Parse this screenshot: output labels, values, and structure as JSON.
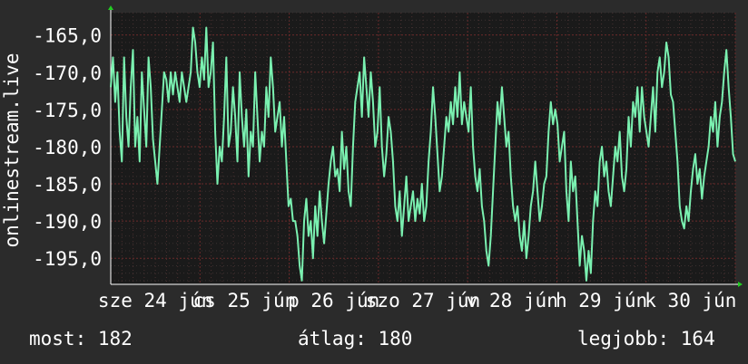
{
  "chart_data": {
    "type": "line",
    "ylabel": "onlinestream.live",
    "y_ticks": [
      -165,
      -170,
      -175,
      -180,
      -185,
      -190,
      -195
    ],
    "y_tick_labels": [
      "-165,0",
      "-170,0",
      "-175,0",
      "-180,0",
      "-185,0",
      "-190,0",
      "-195,0"
    ],
    "ylim": [
      -198.5,
      -162
    ],
    "x_tick_labels": [
      "sze 24 jún",
      "cs 25 jún",
      "p 26 jún",
      "szo 27 jún",
      "v 28 jún",
      "h 29 jún",
      "k 30 jún"
    ],
    "xlim": [
      0,
      7
    ],
    "grid": true,
    "line_color": "#7af0b0",
    "background": "#1a1a1a",
    "series": [
      {
        "values": [
          -172,
          -168,
          -174,
          -170,
          -178,
          -182,
          -168,
          -176,
          -180,
          -172,
          -167,
          -180,
          -176,
          -182,
          -170,
          -175,
          -180,
          -168,
          -172,
          -179,
          -182,
          -185,
          -180,
          -175,
          -170,
          -171,
          -174,
          -170,
          -173,
          -170,
          -172,
          -174,
          -170,
          -172,
          -174,
          -172,
          -170,
          -164,
          -166,
          -170,
          -172,
          -168,
          -171,
          -164,
          -172,
          -170,
          -166,
          -178,
          -185,
          -180,
          -182,
          -176,
          -168,
          -180,
          -178,
          -172,
          -176,
          -182,
          -170,
          -176,
          -180,
          -175,
          -184,
          -178,
          -180,
          -170,
          -176,
          -182,
          -178,
          -180,
          -172,
          -176,
          -168,
          -172,
          -178,
          -176,
          -174,
          -180,
          -176,
          -182,
          -188,
          -187,
          -190,
          -190,
          -192,
          -196,
          -198,
          -190,
          -187,
          -192,
          -190,
          -195,
          -188,
          -192,
          -186,
          -190,
          -193,
          -189,
          -185,
          -182,
          -180,
          -184,
          -183,
          -186,
          -178,
          -183,
          -180,
          -186,
          -188,
          -180,
          -174,
          -172,
          -170,
          -176,
          -168,
          -172,
          -176,
          -170,
          -174,
          -180,
          -178,
          -172,
          -180,
          -184,
          -181,
          -176,
          -178,
          -182,
          -188,
          -190,
          -186,
          -192,
          -188,
          -184,
          -190,
          -188,
          -186,
          -190,
          -187,
          -189,
          -185,
          -190,
          -188,
          -182,
          -178,
          -172,
          -176,
          -181,
          -186,
          -184,
          -180,
          -176,
          -178,
          -174,
          -177,
          -172,
          -176,
          -170,
          -177,
          -174,
          -176,
          -178,
          -172,
          -180,
          -184,
          -186,
          -183,
          -188,
          -190,
          -194,
          -196,
          -192,
          -186,
          -180,
          -174,
          -177,
          -172,
          -176,
          -180,
          -178,
          -184,
          -188,
          -190,
          -188,
          -192,
          -194,
          -190,
          -195,
          -192,
          -188,
          -186,
          -182,
          -186,
          -190,
          -188,
          -185,
          -184,
          -178,
          -174,
          -177,
          -175,
          -177,
          -182,
          -180,
          -178,
          -186,
          -190,
          -182,
          -186,
          -184,
          -190,
          -196,
          -192,
          -194,
          -198,
          -194,
          -197,
          -190,
          -186,
          -188,
          -182,
          -180,
          -184,
          -182,
          -186,
          -188,
          -184,
          -180,
          -182,
          -178,
          -184,
          -186,
          -183,
          -176,
          -180,
          -174,
          -176,
          -172,
          -178,
          -172,
          -176,
          -178,
          -180,
          -176,
          -172,
          -178,
          -170,
          -168,
          -172,
          -170,
          -166,
          -168,
          -173,
          -174,
          -178,
          -182,
          -188,
          -190,
          -191,
          -188,
          -190,
          -186,
          -183,
          -181,
          -185,
          -183,
          -187,
          -184,
          -182,
          -180,
          -176,
          -178,
          -174,
          -180,
          -176,
          -174,
          -170,
          -167,
          -172,
          -176,
          -181,
          -182
        ]
      }
    ]
  },
  "stats": {
    "current": "most: 182",
    "average": "átlag: 180",
    "best": "legjobb: 164"
  }
}
